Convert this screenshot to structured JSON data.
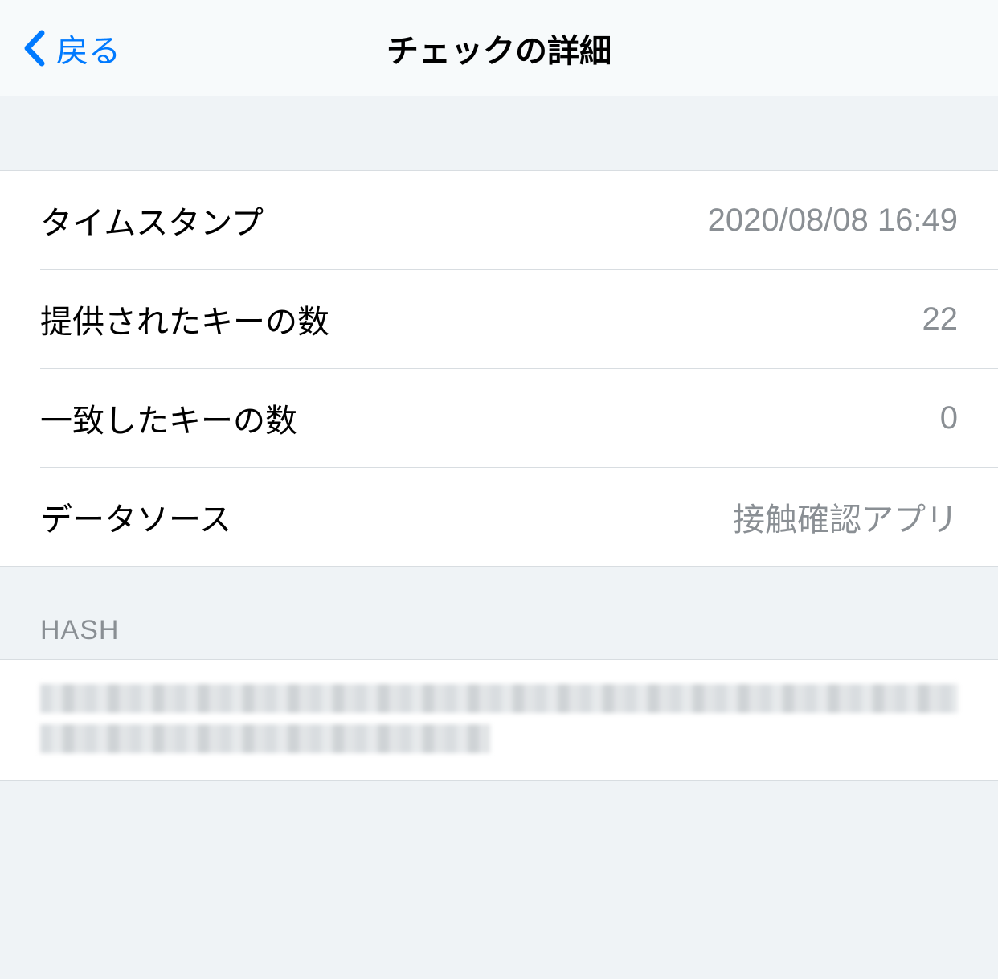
{
  "nav": {
    "back_label": "戻る",
    "title": "チェックの詳細"
  },
  "details": [
    {
      "label": "タイムスタンプ",
      "value": "2020/08/08 16:49"
    },
    {
      "label": "提供されたキーの数",
      "value": "22"
    },
    {
      "label": "一致したキーの数",
      "value": "0"
    },
    {
      "label": "データソース",
      "value": "接触確認アプリ"
    }
  ],
  "hash_section": {
    "header": "HASH"
  }
}
